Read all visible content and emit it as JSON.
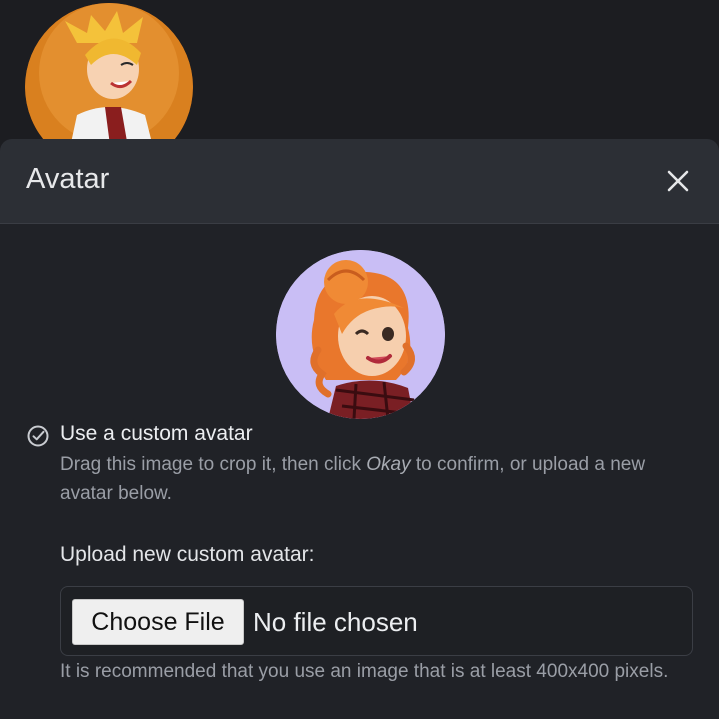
{
  "profile": {
    "avatar_icon": "anime-character-avatar"
  },
  "modal": {
    "title": "Avatar",
    "close_icon": "close-icon",
    "preview_icon": "cartoon-woman-avatar",
    "option": {
      "label": "Use a custom avatar",
      "desc_before": "Drag this image to crop it, then click ",
      "desc_emphasis": "Okay",
      "desc_after": " to confirm, or upload a new avatar below.",
      "selected_icon": "check-circle-icon"
    },
    "upload": {
      "label": "Upload new custom avatar:",
      "button_label": "Choose File",
      "status": "No file chosen",
      "hint": "It is recommended that you use an image that is at least 400x400 pixels."
    }
  },
  "colors": {
    "page_bg": "#1c1d21",
    "modal_bg": "#202227",
    "header_bg": "#2c2f35",
    "preview_bg": "#c9bef5"
  }
}
